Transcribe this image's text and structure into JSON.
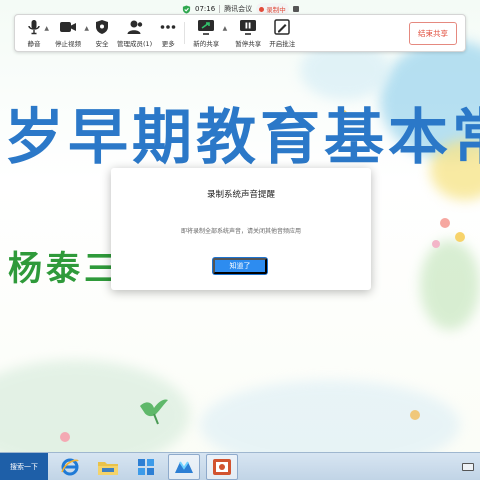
{
  "meeting": {
    "time": "07:16",
    "app_name": "腾讯会议",
    "recording_status": "录制中"
  },
  "toolbar": {
    "items": [
      {
        "label": "静音",
        "icon": "microphone-icon"
      },
      {
        "label": "停止视频",
        "icon": "video-camera-icon"
      },
      {
        "label": "安全",
        "icon": "shield-icon"
      },
      {
        "label": "管理成员(1)",
        "icon": "members-icon"
      },
      {
        "label": "更多",
        "icon": "more-dots-icon"
      },
      {
        "label": "新的共享",
        "icon": "share-screen-icon"
      },
      {
        "label": "暂停共享",
        "icon": "pause-share-icon"
      },
      {
        "label": "开启批注",
        "icon": "annotate-icon"
      }
    ],
    "end_share_label": "结束共享"
  },
  "slide": {
    "title": "岁早期教育基本常",
    "subtitle": "杨泰三 讲座"
  },
  "dialog": {
    "title": "录制系统声音提醒",
    "message": "即将录制全部系统声音，请关闭其他音频应用",
    "confirm_label": "知道了"
  },
  "taskbar": {
    "search_label": "搜索一下",
    "apps": [
      "ie-browser-icon",
      "file-explorer-icon",
      "app-grid-icon",
      "tencent-meeting-icon",
      "powerpoint-icon"
    ]
  },
  "colors": {
    "accent": "#2d8cf0",
    "recording": "#e14b3a",
    "slide_title": "#2b78c8",
    "slide_subtitle": "#2f9a3a"
  }
}
